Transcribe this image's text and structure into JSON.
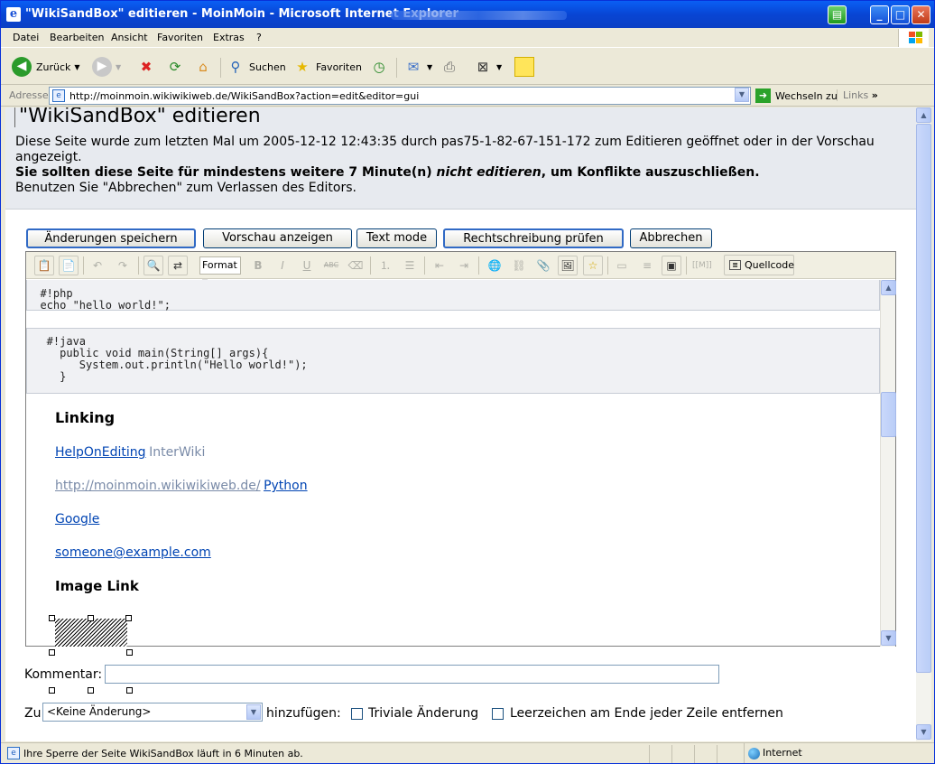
{
  "window": {
    "title": "\"WikiSandBox\" editieren - MoinMoin - Microsoft Internet Explorer"
  },
  "menu": [
    "Datei",
    "Bearbeiten",
    "Ansicht",
    "Favoriten",
    "Extras",
    "?"
  ],
  "toolbar": {
    "back_label": "Zurück",
    "search_label": "Suchen",
    "favorites_label": "Favoriten"
  },
  "address": {
    "label": "Adresse",
    "url": "http://moinmoin.wikiwikiweb.de/WikiSandBox?action=edit&editor=gui",
    "go_label": "Wechseln zu",
    "links_label": "Links"
  },
  "page": {
    "heading": "\"WikiSandBox\" editieren",
    "notice_line1": "Diese Seite wurde zum letzten Mal um 2005-12-12 12:43:35 durch pas75-1-82-67-151-172 zum Editieren geöffnet oder in der Vorschau angezeigt.",
    "notice_bold_a": "Sie sollten diese Seite für mindestens weitere 7 Minute(n) ",
    "notice_bold_em": "nicht editieren",
    "notice_bold_b": ", um Konflikte auszuschließen.",
    "notice_line3": "Benutzen Sie \"Abbrechen\" zum Verlassen des Editors."
  },
  "buttons": {
    "save": "Änderungen speichern",
    "preview": "Vorschau anzeigen",
    "textmode": "Text mode",
    "spellcheck": "Rechtschreibung prüfen",
    "cancel": "Abbrechen"
  },
  "editor_toolbar": {
    "format_label": "Format",
    "source_label": "Quellcode"
  },
  "editor": {
    "code_php": "  #!php\n  echo \"hello world!\";",
    "code_java": "   #!java\n     public void main(String[] args){\n        System.out.println(\"Hello world!\");\n     }",
    "heading_linking": "Linking",
    "link_helponediting": "HelpOnEditing",
    "link_interwiki": "InterWiki",
    "link_url": "http://moinmoin.wikiwikiweb.de/",
    "link_python": "Python",
    "link_google": "Google",
    "link_email": "someone@example.com",
    "heading_imagelink": "Image Link"
  },
  "form": {
    "comment_label": "Kommentar:",
    "comment_value": "",
    "zu_label": "Zu",
    "category_selected": "<Keine Änderung>",
    "add_label": "hinzufügen:",
    "trivial_label": "Triviale Änderung",
    "trivial_checked": false,
    "strip_label": "Leerzeichen am Ende jeder Zeile entfernen",
    "strip_checked": false
  },
  "status": {
    "text": "Ihre Sperre der Seite WikiSandBox läuft in 6 Minuten ab.",
    "zone": "Internet"
  },
  "colors": {
    "link": "#0044b3",
    "link_visited": "#7a8ba8",
    "header_bg": "#e7eaef"
  }
}
